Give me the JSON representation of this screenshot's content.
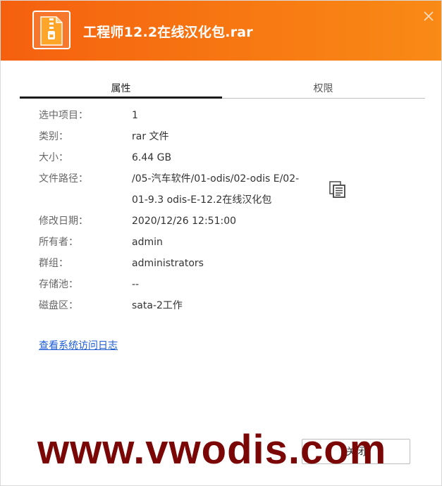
{
  "window": {
    "title": "工程师12.2在线汉化包.rar",
    "file_icon": "zip-archive-icon",
    "close_icon": "close-icon",
    "accent_color": "#f77812"
  },
  "tabs": [
    {
      "label": "属性",
      "active": true
    },
    {
      "label": "权限",
      "active": false
    }
  ],
  "properties": [
    {
      "label": "选中项目：",
      "value": "1"
    },
    {
      "label": "类别：",
      "value": "rar 文件"
    },
    {
      "label": "大小：",
      "value": "6.44 GB"
    },
    {
      "label": "文件路径：",
      "value_lines": [
        "/05-汽车软件/01-odis/02-odis E/02-",
        "01-9.3 odis-E-12.2在线汉化包"
      ]
    },
    {
      "label": "修改日期：",
      "value": "2020/12/26 12:51:00"
    },
    {
      "label": "所有者：",
      "value": "admin"
    },
    {
      "label": "群组：",
      "value": "administrators"
    },
    {
      "label": "存储池：",
      "value": "--"
    },
    {
      "label": "磁盘区：",
      "value": "sata-2工作"
    }
  ],
  "copy_icon": "copy-icon",
  "links": {
    "system_log": "查看系统访问日志"
  },
  "footer": {
    "close_label": "关闭"
  },
  "watermark": "www.vwodis.com"
}
